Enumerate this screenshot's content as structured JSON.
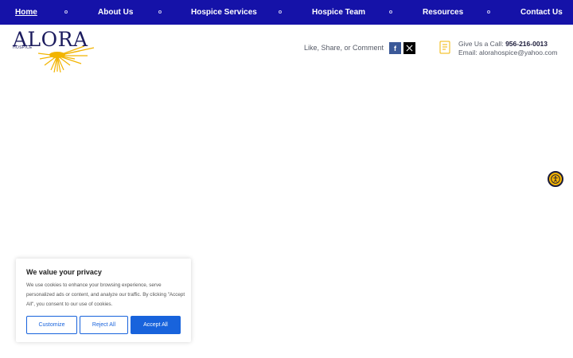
{
  "nav": {
    "items": [
      {
        "label": "Home",
        "active": true
      },
      {
        "label": "About Us"
      },
      {
        "label": "Hospice Services"
      },
      {
        "label": "Hospice Team"
      },
      {
        "label": "Resources"
      },
      {
        "label": "Contact Us"
      }
    ]
  },
  "logo": {
    "name": "ALORA",
    "sub": "HOSPICE"
  },
  "social": {
    "share_text": "Like, Share, or Comment",
    "facebook_icon": "facebook-icon",
    "x_icon": "x-icon"
  },
  "contact": {
    "call_label": "Give Us a Call:",
    "phone": "956-216-0013",
    "email_label": "Email:",
    "email": "alorahospice@yahoo.com"
  },
  "accessibility": {
    "icon": "accessibility-icon"
  },
  "cookie": {
    "title": "We value your privacy",
    "body": "We use cookies to enhance your browsing experience, serve personalized ads or content, and analyze our traffic. By clicking \"Accept All\", you consent to our use of cookies.",
    "customize": "Customize",
    "reject": "Reject All",
    "accept": "Accept All"
  },
  "colors": {
    "nav_bg": "#1512a8",
    "accent": "#1863dc",
    "logo_text": "#1b1b5e",
    "sun": "#f2b400"
  }
}
